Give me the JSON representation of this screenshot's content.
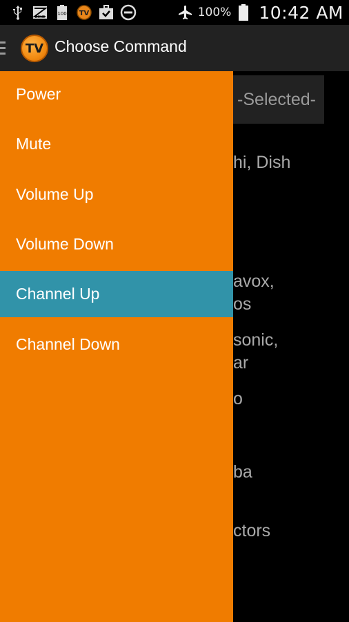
{
  "status_bar": {
    "icons": [
      "usb-icon",
      "zone-icon",
      "battery-100-icon",
      "tv-app-icon",
      "briefcase-check-icon",
      "do-not-disturb-icon"
    ],
    "battery_small_label": "100",
    "right_icons": [
      "airplane-mode-icon",
      "battery-icon"
    ],
    "battery_percent": "100%",
    "time": "10:42 AM"
  },
  "action_bar": {
    "logo_text": "TV",
    "title": "Choose Command"
  },
  "background": {
    "select_text": "-Selected-",
    "lines": [
      "hi, Dish",
      "avox,",
      "os",
      "sonic,",
      "ar",
      "o",
      "ba",
      "ctors"
    ]
  },
  "drawer": {
    "items": [
      {
        "label": "Power"
      },
      {
        "label": "Mute"
      },
      {
        "label": "Volume Up"
      },
      {
        "label": "Volume Down"
      },
      {
        "label": "Channel Up",
        "selected": true
      },
      {
        "label": "Channel Down"
      }
    ]
  },
  "colors": {
    "drawer_bg": "#f07c00",
    "selected_bg": "#3193a9",
    "action_bar_bg": "#222222"
  }
}
